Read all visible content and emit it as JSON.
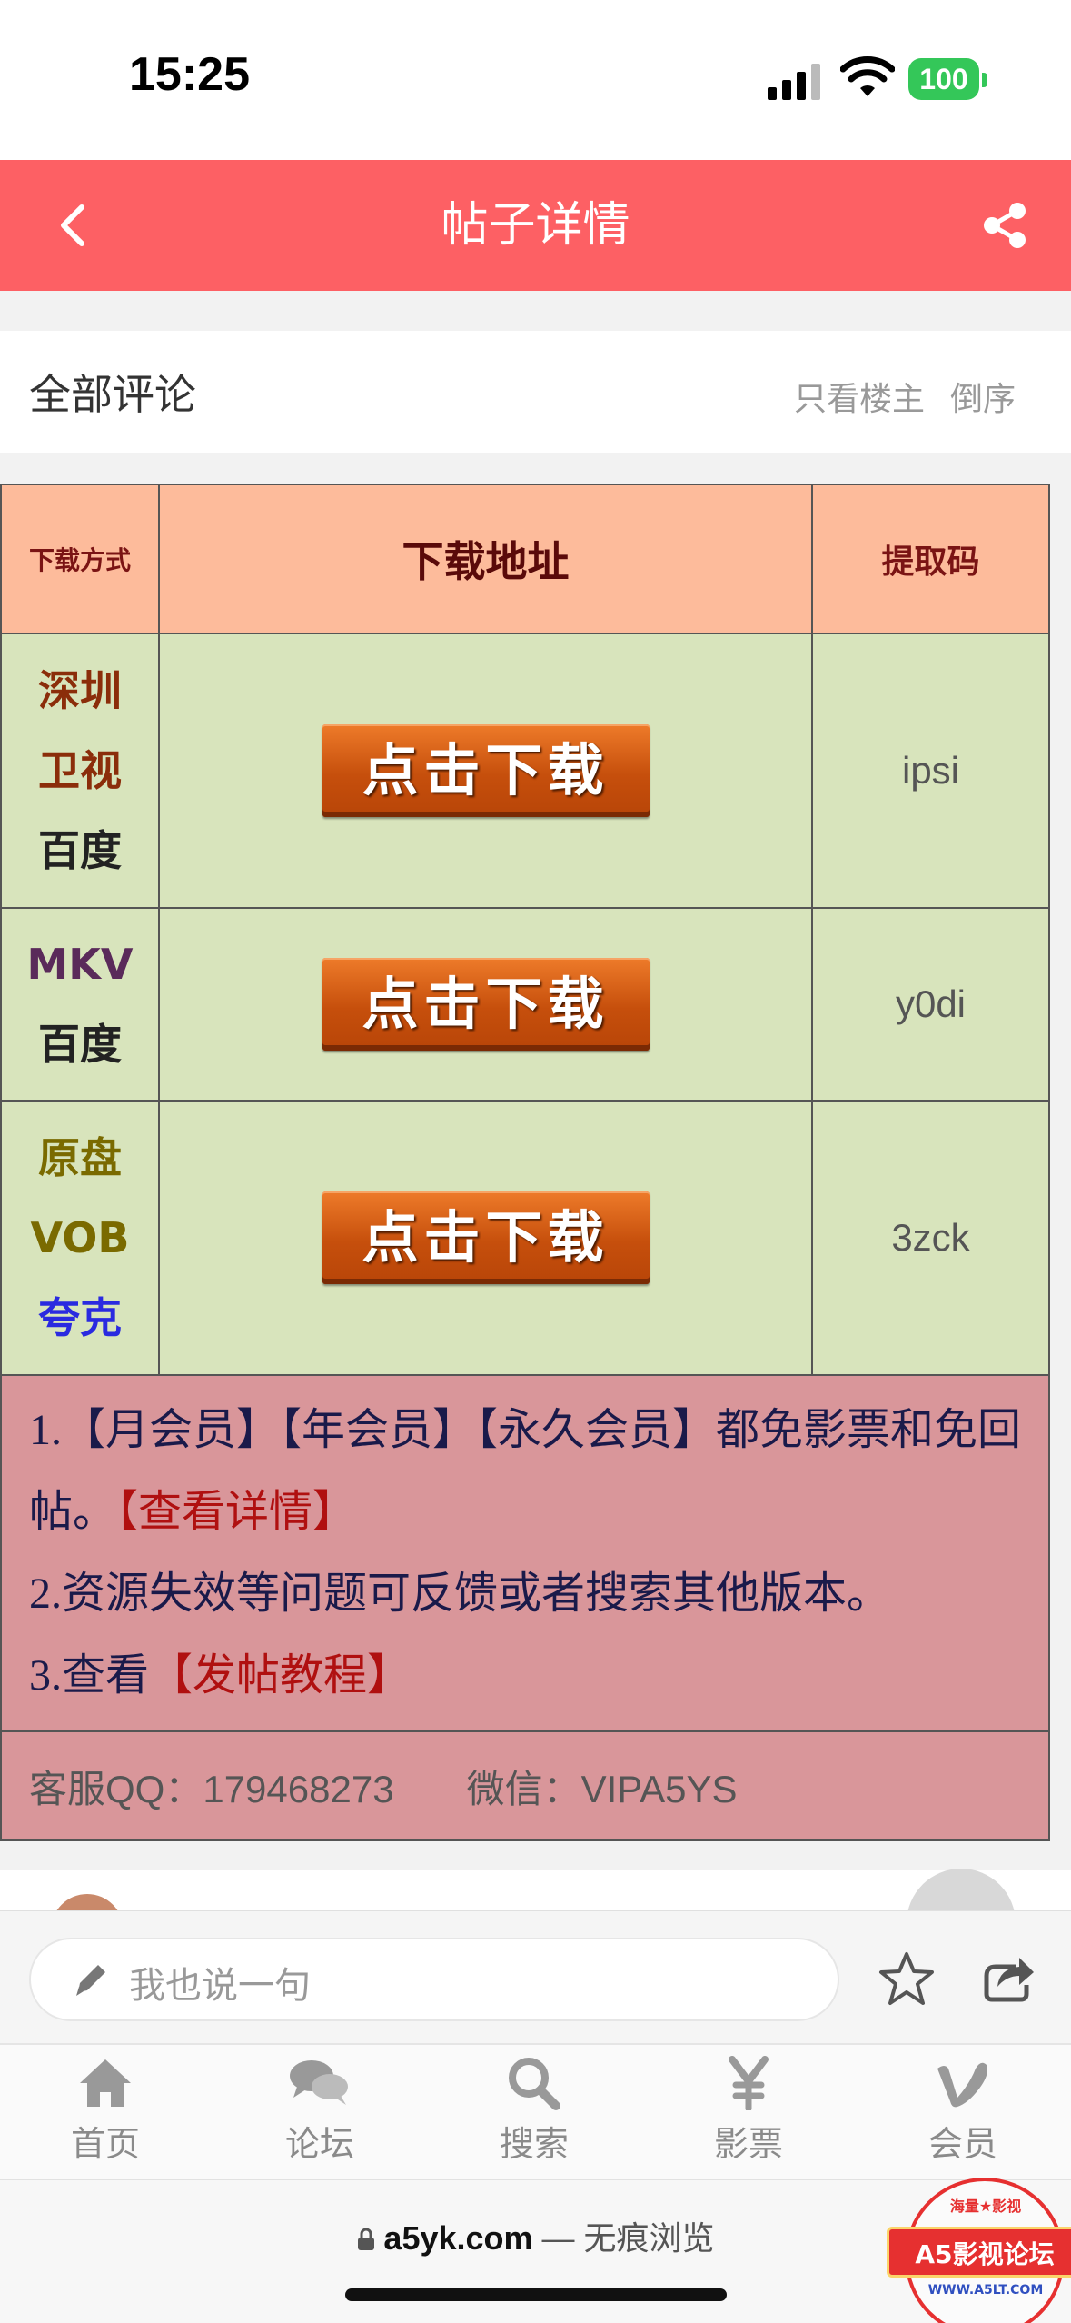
{
  "status_bar": {
    "time": "15:25",
    "battery": "100"
  },
  "header": {
    "title": "帖子详情"
  },
  "comments_bar": {
    "title": "全部评论",
    "only_op": "只看楼主",
    "reverse": "倒序"
  },
  "download_table": {
    "headers": {
      "type": "下载方式",
      "address": "下载地址",
      "code": "提取码"
    },
    "rows": [
      {
        "type_lines": [
          "深圳",
          "卫视",
          "百度"
        ],
        "type_colors": [
          "#8b2d0a",
          "#8b2d0a",
          "#222222"
        ],
        "button": "点击下载",
        "code": "ipsi"
      },
      {
        "type_lines": [
          "MKV",
          "百度"
        ],
        "type_colors": [
          "#5a2a5a",
          "#222222"
        ],
        "button": "点击下载",
        "code": "y0di"
      },
      {
        "type_lines": [
          "原盘",
          "VOB",
          "夸克"
        ],
        "type_colors": [
          "#7a6a00",
          "#7a6a00",
          "#2a2ae0"
        ],
        "button": "点击下载",
        "code": "3zck"
      }
    ],
    "notes": {
      "line1_prefix": "1.【月会员】【年会员】【永久会员】都免影票和免回帖。",
      "line1_link": "【查看详情】",
      "line2": "2.资源失效等问题可反馈或者搜索其他版本。",
      "line3_prefix": "3.查看",
      "line3_link": "【发帖教程】"
    },
    "support": {
      "qq": "客服QQ：179468273",
      "wechat": "微信：VIPA5YS"
    }
  },
  "reply_bar": {
    "placeholder": "我也说一句"
  },
  "tabs": [
    {
      "label": "首页",
      "icon": "home-icon"
    },
    {
      "label": "论坛",
      "icon": "chat-icon"
    },
    {
      "label": "搜索",
      "icon": "search-icon"
    },
    {
      "label": "影票",
      "icon": "yen-icon"
    },
    {
      "label": "会员",
      "icon": "vip-icon"
    }
  ],
  "browser": {
    "domain": "a5yk.com",
    "mode": "— 无痕浏览"
  },
  "watermark": {
    "label": "A5影视论坛",
    "top": "海量★影视",
    "url": "WWW.A5LT.COM"
  },
  "colors": {
    "header": "#fd6064",
    "table_header": "#fdbb9b",
    "table_row": "#d8e4bc",
    "notes_bg": "#d9969a",
    "notes_link": "#b01010"
  }
}
